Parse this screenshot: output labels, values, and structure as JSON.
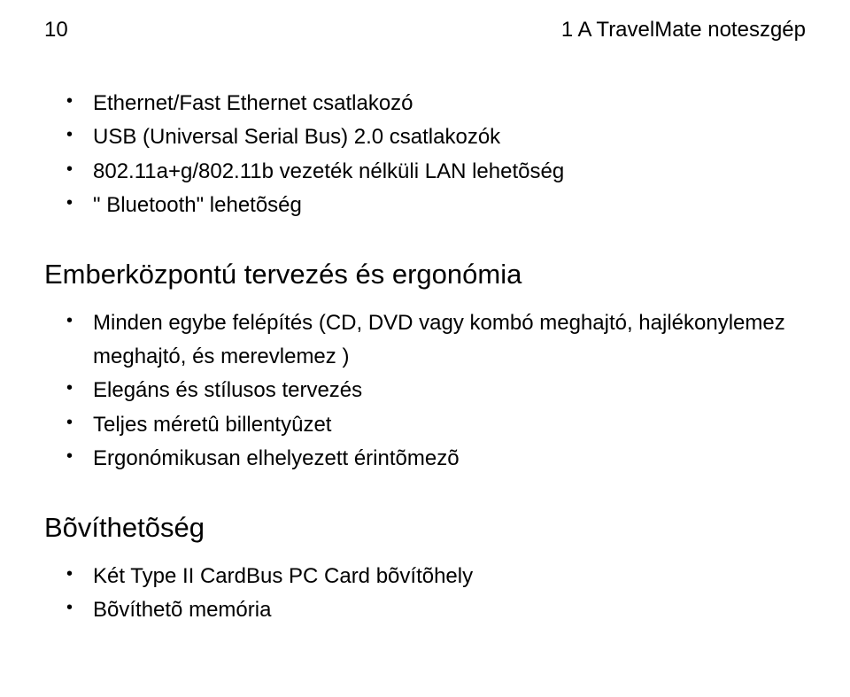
{
  "header": {
    "page_number": "10",
    "chapter": "1   A TravelMate noteszgép"
  },
  "list1": {
    "items": [
      "Ethernet/Fast Ethernet csatlakozó",
      "USB (Universal Serial Bus) 2.0 csatlakozók",
      "802.11a+g/802.11b vezeték nélküli LAN lehetõség",
      "\" Bluetooth\" lehetõség"
    ]
  },
  "section2": {
    "heading": "Emberközpontú tervezés és ergonómia",
    "items": [
      "Minden egybe felépítés (CD, DVD vagy kombó meghajtó, hajlékonylemez meghajtó, és merevlemez )",
      "Elegáns és stílusos tervezés",
      "Teljes méretû billentyûzet",
      "Ergonómikusan elhelyezett érintõmezõ"
    ]
  },
  "section3": {
    "heading": "Bõvíthetõség",
    "items": [
      "Két Type II CardBus PC Card bõvítõhely",
      "Bõvíthetõ memória"
    ]
  }
}
